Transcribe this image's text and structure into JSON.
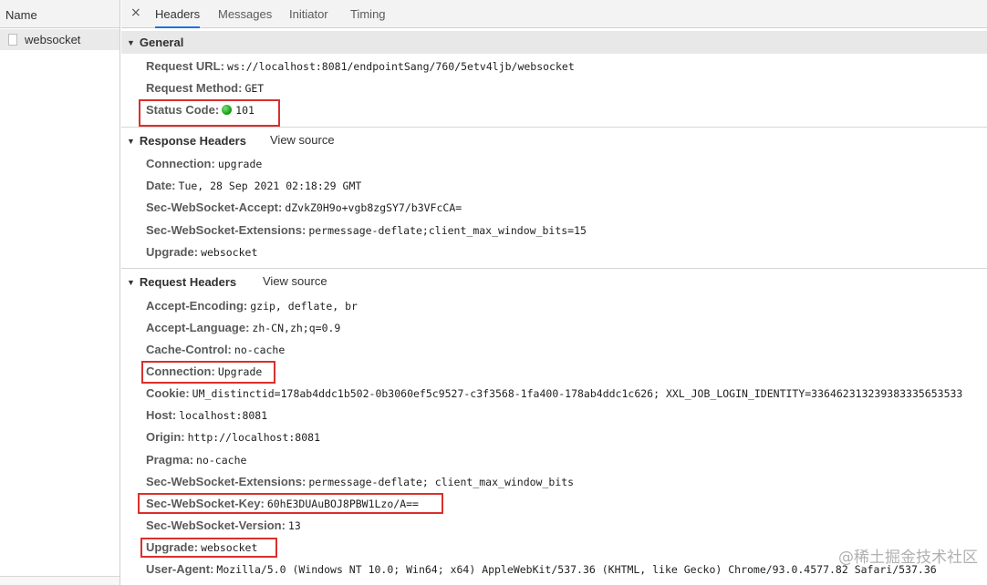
{
  "sidebar": {
    "header": "Name",
    "items": [
      {
        "label": "websocket"
      }
    ]
  },
  "tabs": [
    "Headers",
    "Messages",
    "Initiator",
    "Timing"
  ],
  "close_glyph": "×",
  "general": {
    "title": "General",
    "rows": [
      {
        "key": "Request URL:",
        "value": "ws://localhost:8081/endpointSang/760/5etv4ljb/websocket"
      },
      {
        "key": "Request Method:",
        "value": "GET"
      },
      {
        "key": "Status Code:",
        "value": "101"
      }
    ]
  },
  "response_headers": {
    "title": "Response Headers",
    "view_source": "View source",
    "rows": [
      {
        "key": "Connection:",
        "value": "upgrade"
      },
      {
        "key": "Date:",
        "value": "Tue, 28 Sep 2021 02:18:29 GMT"
      },
      {
        "key": "Sec-WebSocket-Accept:",
        "value": "dZvkZ0H9o+vgb8zgSY7/b3VFcCA="
      },
      {
        "key": "Sec-WebSocket-Extensions:",
        "value": "permessage-deflate;client_max_window_bits=15"
      },
      {
        "key": "Upgrade:",
        "value": "websocket"
      }
    ]
  },
  "request_headers": {
    "title": "Request Headers",
    "view_source": "View source",
    "rows": [
      {
        "key": "Accept-Encoding:",
        "value": "gzip, deflate, br"
      },
      {
        "key": "Accept-Language:",
        "value": "zh-CN,zh;q=0.9"
      },
      {
        "key": "Cache-Control:",
        "value": "no-cache"
      },
      {
        "key": "Connection:",
        "value": "Upgrade"
      },
      {
        "key": "Cookie:",
        "value": "UM_distinctid=178ab4ddc1b502-0b3060ef5c9527-c3f3568-1fa400-178ab4ddc1c626; XXL_JOB_LOGIN_IDENTITY=336462313239383335653533"
      },
      {
        "key": "Host:",
        "value": "localhost:8081"
      },
      {
        "key": "Origin:",
        "value": "http://localhost:8081"
      },
      {
        "key": "Pragma:",
        "value": "no-cache"
      },
      {
        "key": "Sec-WebSocket-Extensions:",
        "value": "permessage-deflate; client_max_window_bits"
      },
      {
        "key": "Sec-WebSocket-Key:",
        "value": "60hE3DUAuBOJ8PBW1Lzo/A=="
      },
      {
        "key": "Sec-WebSocket-Version:",
        "value": "13"
      },
      {
        "key": "Upgrade:",
        "value": "websocket"
      },
      {
        "key": "User-Agent:",
        "value": "Mozilla/5.0 (Windows NT 10.0; Win64; x64) AppleWebKit/537.36 (KHTML, like Gecko) Chrome/93.0.4577.82 Safari/537.36"
      }
    ]
  },
  "status_color": "#0a9b0a",
  "highlight_color": "#d9302c",
  "watermark": "@稀土掘金技术社区"
}
